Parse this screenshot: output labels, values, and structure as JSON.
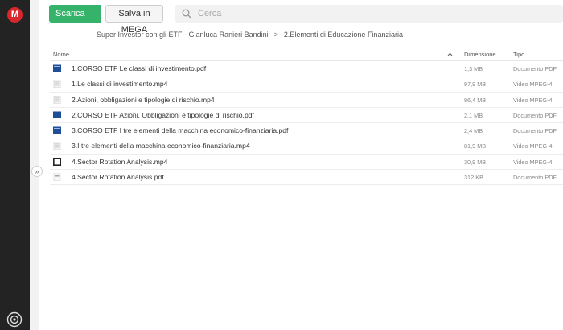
{
  "sidebar": {
    "logo_letter": "M"
  },
  "toolbar": {
    "download_label": "Scarica",
    "save_label": "Salva in MEGA",
    "search_placeholder": "Cerca"
  },
  "breadcrumb": {
    "parent": "Super Investor con gli ETF - Gianluca Ranieri Bandini",
    "separator": ">",
    "current": "2.Elementi di Educazione Finanziaria"
  },
  "table": {
    "columns": {
      "name": "Nome",
      "size": "Dimensione",
      "type": "Tipo"
    },
    "rows": [
      {
        "name": "1.CORSO ETF Le classi di investimento.pdf",
        "size": "1,3 MB",
        "type": "Documento PDF",
        "icon": "pdf-blue-icon"
      },
      {
        "name": "1.Le classi di investimento.mp4",
        "size": "97,9 MB",
        "type": "Video MPEG-4",
        "icon": "video-thumb-icon"
      },
      {
        "name": "2.Azioni, obbligazioni e tipologie di rischio.mp4",
        "size": "96,4 MB",
        "type": "Video MPEG-4",
        "icon": "video-thumb-icon"
      },
      {
        "name": "2.CORSO ETF Azioni, Obbligazioni e tipologie di rischio.pdf",
        "size": "2,1 MB",
        "type": "Documento PDF",
        "icon": "pdf-blue-icon"
      },
      {
        "name": "3.CORSO ETF I tre elementi della macchina economico-finanziaria.pdf",
        "size": "2,4 MB",
        "type": "Documento PDF",
        "icon": "pdf-blue-icon"
      },
      {
        "name": "3.I tre elementi della macchina economico-finanziaria.mp4",
        "size": "81,9 MB",
        "type": "Video MPEG-4",
        "icon": "video-thumb-icon"
      },
      {
        "name": "4.Sector Rotation Analysis.mp4",
        "size": "30,9 MB",
        "type": "Video MPEG-4",
        "icon": "video-dark-icon"
      },
      {
        "name": "4.Sector Rotation Analysis.pdf",
        "size": "312 KB",
        "type": "Documento PDF",
        "icon": "pdf-thumb-icon"
      }
    ]
  },
  "colors": {
    "accent": "#35b36a",
    "brand": "#d9272e",
    "sidebar": "#232323"
  }
}
